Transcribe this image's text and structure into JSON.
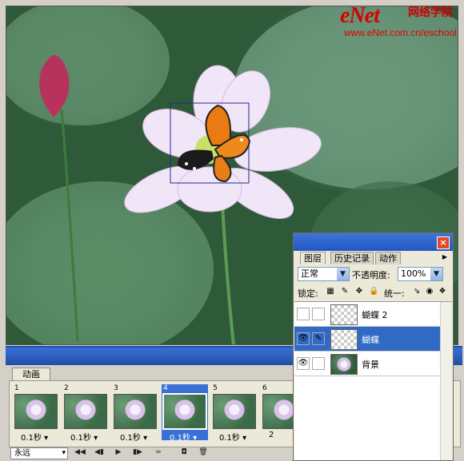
{
  "watermark": {
    "logo": "eNet",
    "cn": "网络学院",
    "url": "www.eNet.com.cn/eschool"
  },
  "animation": {
    "tab": "动画",
    "frames": [
      {
        "num": "1",
        "delay": "0.1秒"
      },
      {
        "num": "2",
        "delay": "0.1秒"
      },
      {
        "num": "3",
        "delay": "0.1秒"
      },
      {
        "num": "4",
        "delay": "0.1秒",
        "selected": true
      },
      {
        "num": "5",
        "delay": "0.1秒"
      },
      {
        "num": "6",
        "delay": "2"
      }
    ],
    "loop": "永远",
    "toolbar": [
      "◀◀",
      "◀▮",
      "▶",
      "▮▶",
      "∞",
      "◘",
      "🗑"
    ]
  },
  "layers_panel": {
    "close": "×",
    "tabs": [
      "图层",
      "历史记录",
      "动作"
    ],
    "blend_mode": "正常",
    "opacity_label": "不透明度:",
    "opacity": "100%",
    "lock_label": "锁定:",
    "unify_label": "统一:",
    "layers": [
      {
        "name": "蝴蝶 2",
        "visible": false,
        "selected": false,
        "thumb": "transparent"
      },
      {
        "name": "蝴蝶",
        "visible": true,
        "selected": true,
        "thumb": "transparent"
      },
      {
        "name": "背景",
        "visible": true,
        "selected": false,
        "thumb": "image"
      }
    ]
  }
}
